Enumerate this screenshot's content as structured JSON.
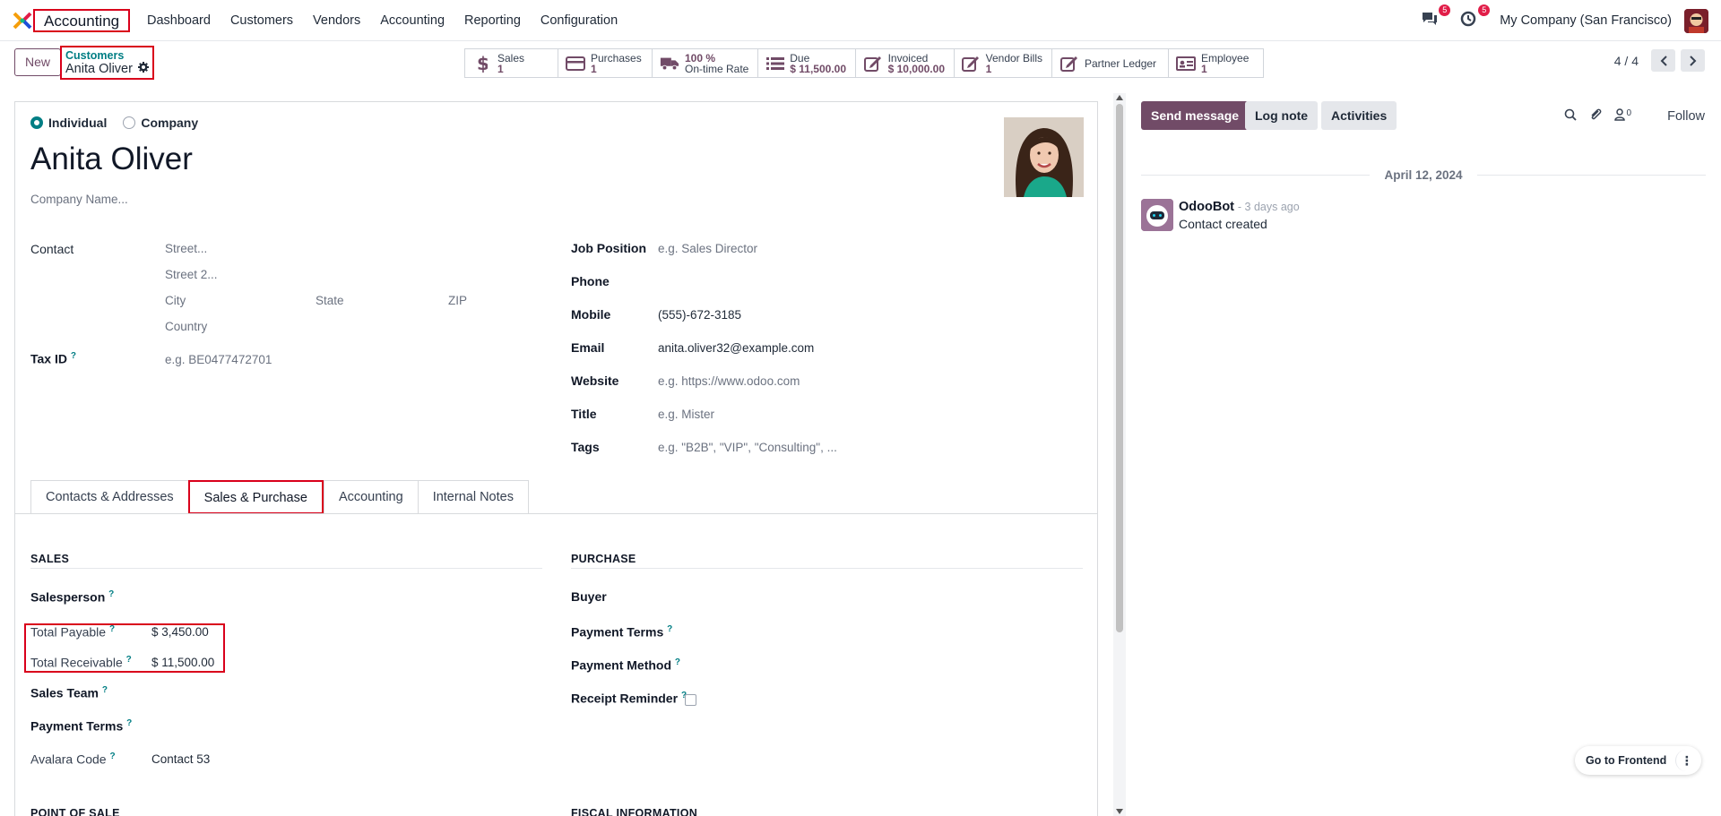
{
  "app": {
    "name": "Accounting",
    "logo_icon": "odoo-multicolor-x-logo"
  },
  "top_menu": [
    "Dashboard",
    "Customers",
    "Vendors",
    "Accounting",
    "Reporting",
    "Configuration"
  ],
  "systray": {
    "messages_icon": "chat-bubbles-icon",
    "messages_count": "5",
    "activities_icon": "clock-icon",
    "activities_count": "5",
    "company": "My Company (San Francisco)"
  },
  "control_panel": {
    "new_label": "New",
    "breadcrumb_parent": "Customers",
    "breadcrumb_current": "Anita Oliver",
    "pager": "4 / 4"
  },
  "smart_buttons": [
    {
      "icon": "dollar-icon",
      "label": "Sales",
      "value": "1"
    },
    {
      "icon": "credit-card-icon",
      "label": "Purchases",
      "value": "1"
    },
    {
      "icon": "truck-icon",
      "label": "100  %",
      "value": "On-time Rate",
      "label_bold": true
    },
    {
      "icon": "list-icon",
      "label": "Due",
      "value": "$ 11,500.00"
    },
    {
      "icon": "pencil-square-icon",
      "label": "Invoiced",
      "value": "$ 10,000.00"
    },
    {
      "icon": "pencil-square-icon",
      "label": "Vendor Bills",
      "value": "1"
    },
    {
      "icon": "pencil-square-icon",
      "label": "Partner Ledger",
      "value": ""
    },
    {
      "icon": "id-card-icon",
      "label": "Employee",
      "value": "1"
    }
  ],
  "form": {
    "type_individual": "Individual",
    "type_company": "Company",
    "name": "Anita Oliver",
    "company_name_placeholder": "Company Name...",
    "contact_label": "Contact",
    "street_ph": "Street...",
    "street2_ph": "Street 2...",
    "city_ph": "City",
    "state_ph": "State",
    "zip_ph": "ZIP",
    "country_ph": "Country",
    "taxid_label": "Tax ID",
    "taxid_ph": "e.g. BE0477472701",
    "job_label": "Job Position",
    "job_ph": "e.g. Sales Director",
    "phone_label": "Phone",
    "mobile_label": "Mobile",
    "mobile_value": "(555)-672-3185",
    "email_label": "Email",
    "email_value": "anita.oliver32@example.com",
    "website_label": "Website",
    "website_ph": "e.g. https://www.odoo.com",
    "title_label": "Title",
    "title_ph": "e.g. Mister",
    "tags_label": "Tags",
    "tags_ph": "e.g. \"B2B\", \"VIP\", \"Consulting\", ..."
  },
  "tabs": [
    "Contacts & Addresses",
    "Sales & Purchase",
    "Accounting",
    "Internal Notes"
  ],
  "active_tab": "Sales & Purchase",
  "sales": {
    "title": "SALES",
    "salesperson": "Salesperson",
    "total_payable_label": "Total Payable",
    "total_payable": "$ 3,450.00",
    "total_receivable_label": "Total Receivable",
    "total_receivable": "$ 11,500.00",
    "sales_team": "Sales Team",
    "payment_terms": "Payment Terms",
    "avalara_label": "Avalara Code",
    "avalara_value": "Contact 53",
    "pos_title": "POINT OF SALE"
  },
  "purchase": {
    "title": "PURCHASE",
    "buyer": "Buyer",
    "payment_terms": "Payment Terms",
    "payment_method": "Payment Method",
    "receipt_reminder": "Receipt Reminder",
    "fiscal_title": "FISCAL INFORMATION"
  },
  "chatter": {
    "send_message": "Send message",
    "log_note": "Log note",
    "activities": "Activities",
    "followers_count": "0",
    "follow": "Follow",
    "date": "April 12, 2024",
    "author": "OdooBot",
    "ago": "- 3 days ago",
    "body": "Contact created"
  },
  "frontend": {
    "label": "Go to Frontend"
  },
  "colors": {
    "brand": "#714b67",
    "teal": "#017e84",
    "highlight": "#d9001b"
  }
}
